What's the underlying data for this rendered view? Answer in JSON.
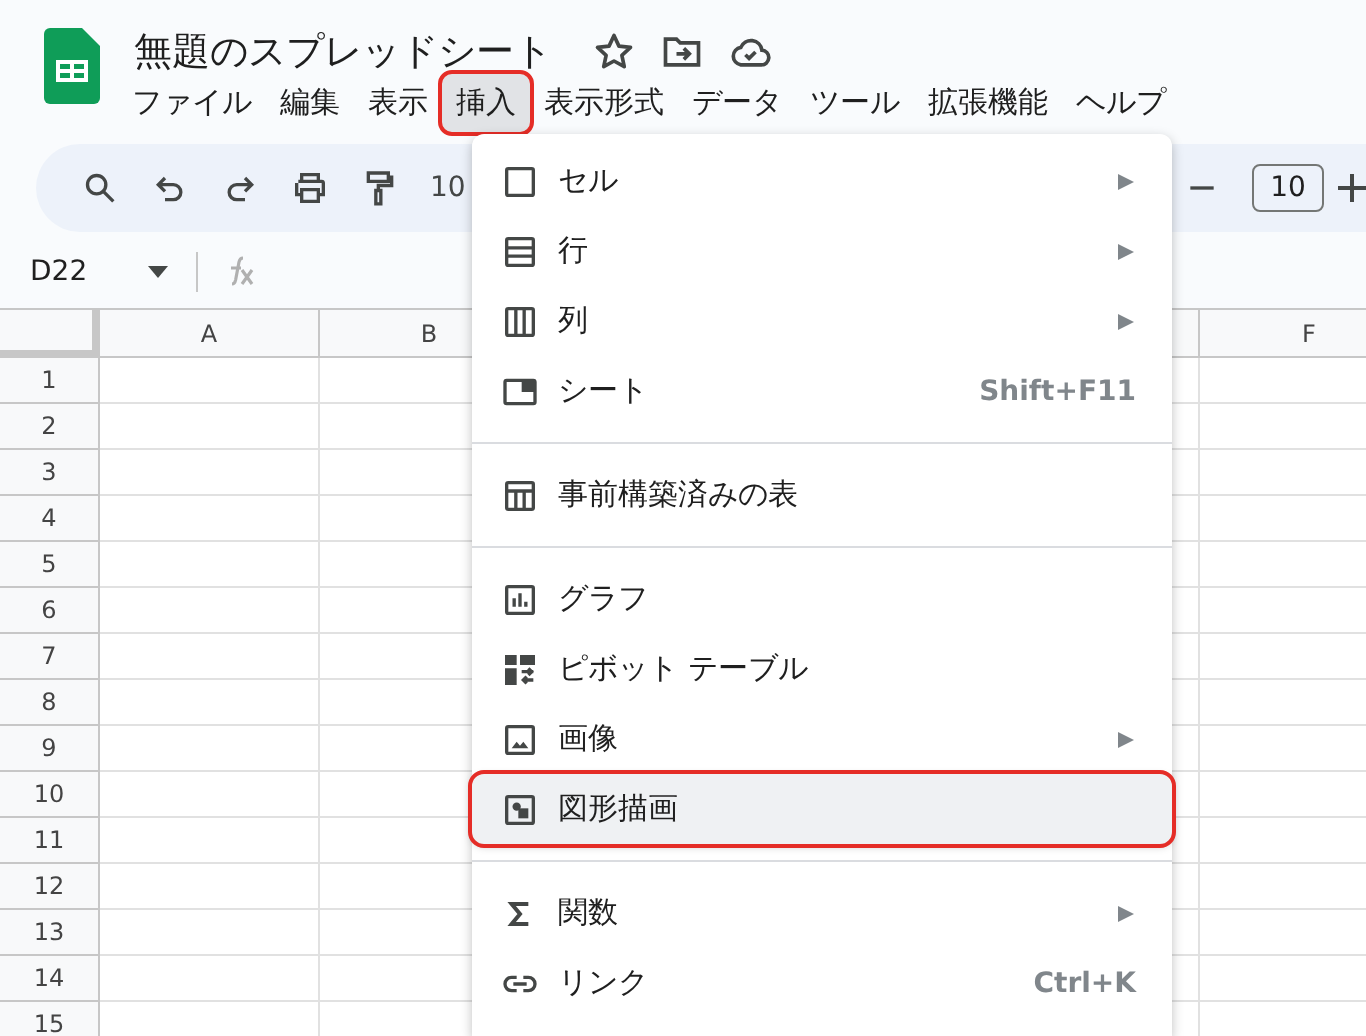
{
  "app": {
    "title": "無題のスプレッドシート"
  },
  "menubar": [
    {
      "label": "ファイル",
      "selected": false,
      "annotated": false
    },
    {
      "label": "編集",
      "selected": false,
      "annotated": false
    },
    {
      "label": "表示",
      "selected": false,
      "annotated": false
    },
    {
      "label": "挿入",
      "selected": true,
      "annotated": true
    },
    {
      "label": "表示形式",
      "selected": false,
      "annotated": false
    },
    {
      "label": "データ",
      "selected": false,
      "annotated": false
    },
    {
      "label": "ツール",
      "selected": false,
      "annotated": false
    },
    {
      "label": "拡張機能",
      "selected": false,
      "annotated": false
    },
    {
      "label": "ヘルプ",
      "selected": false,
      "annotated": false
    }
  ],
  "toolbar": {
    "zoom": "10",
    "font_size": "10"
  },
  "formula_bar": {
    "cell_ref": "D22"
  },
  "grid": {
    "columns": [
      "A",
      "B",
      "F"
    ],
    "rows": [
      "1",
      "2",
      "3",
      "4",
      "5",
      "6",
      "7",
      "8",
      "9",
      "10",
      "11",
      "12",
      "13",
      "14",
      "15"
    ]
  },
  "insert_menu": {
    "sections": [
      [
        {
          "label": "セル",
          "submenu": true,
          "highlighted": false,
          "annotated": false
        },
        {
          "label": "行",
          "submenu": true,
          "highlighted": false,
          "annotated": false
        },
        {
          "label": "列",
          "submenu": true,
          "highlighted": false,
          "annotated": false
        },
        {
          "label": "シート",
          "submenu": false,
          "shortcut": "Shift+F11",
          "highlighted": false,
          "annotated": false
        }
      ],
      [
        {
          "label": "事前構築済みの表",
          "submenu": false,
          "highlighted": false,
          "annotated": false
        }
      ],
      [
        {
          "label": "グラフ",
          "submenu": false,
          "highlighted": false,
          "annotated": false
        },
        {
          "label": "ピボット テーブル",
          "submenu": false,
          "highlighted": false,
          "annotated": false
        },
        {
          "label": "画像",
          "submenu": true,
          "highlighted": false,
          "annotated": false
        },
        {
          "label": "図形描画",
          "submenu": false,
          "highlighted": true,
          "annotated": true
        }
      ],
      [
        {
          "label": "関数",
          "submenu": true,
          "highlighted": false,
          "annotated": false
        },
        {
          "label": "リンク",
          "submenu": false,
          "shortcut": "Ctrl+K",
          "highlighted": false,
          "annotated": false
        }
      ]
    ]
  }
}
